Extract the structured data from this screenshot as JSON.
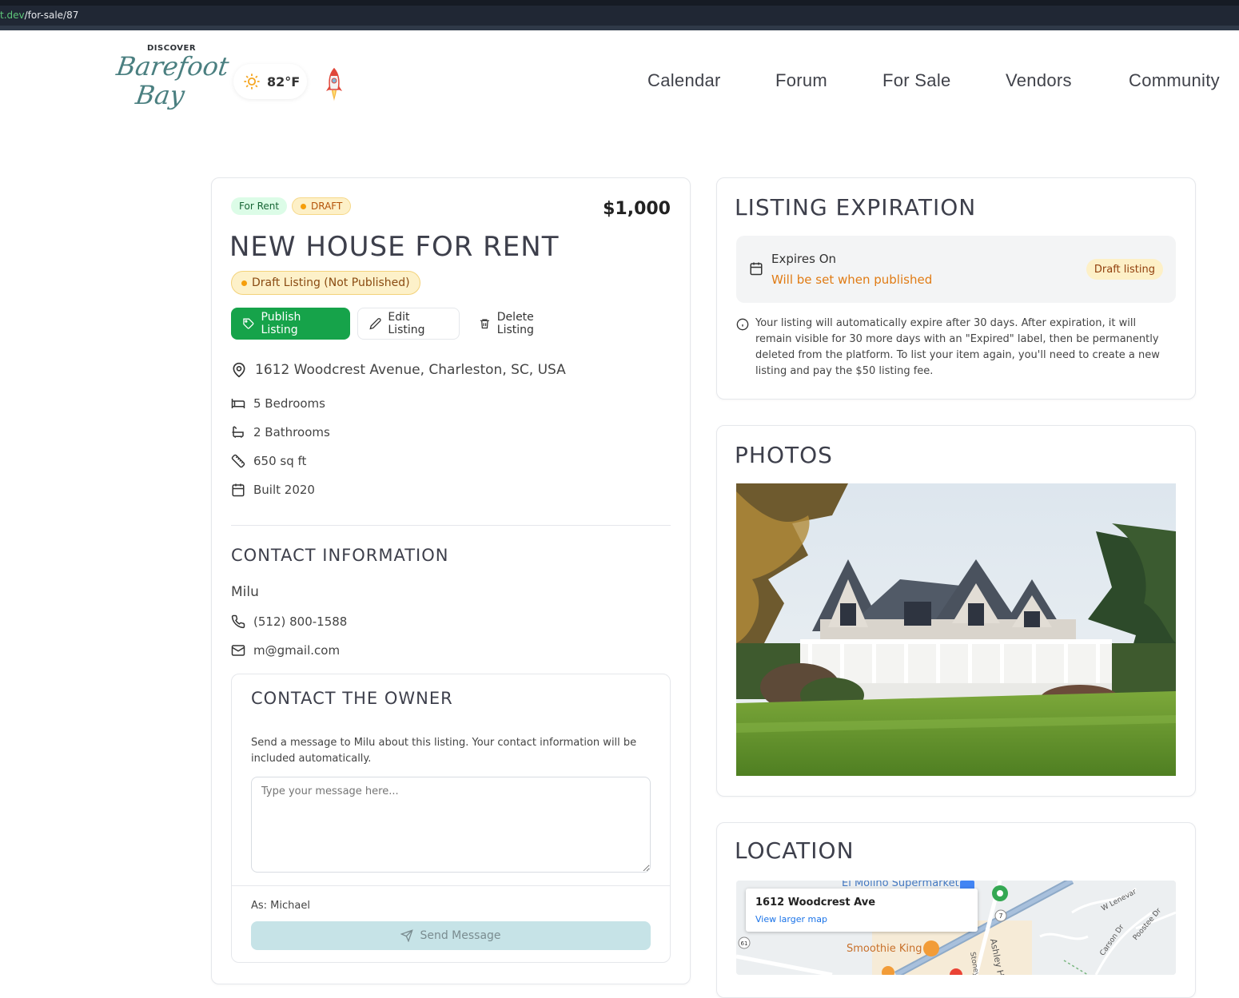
{
  "browser": {
    "url_host": "t.dev",
    "url_path": "/for-sale/87"
  },
  "header": {
    "logo": {
      "line1": "DISCOVER",
      "line2": "Barefoot",
      "line3": "Bay"
    },
    "weather": {
      "temp": "82°F",
      "icon": "sun-icon"
    },
    "nav": [
      "Calendar",
      "Forum",
      "For Sale",
      "Vendors",
      "Community"
    ]
  },
  "listing": {
    "type_badge": "For Rent",
    "status_badge": "DRAFT",
    "price": "$1,000",
    "title": "NEW HOUSE FOR RENT",
    "draft_banner": "Draft Listing (Not Published)",
    "actions": {
      "publish": "Publish Listing",
      "edit": "Edit Listing",
      "delete": "Delete Listing"
    },
    "address": "1612 Woodcrest Avenue, Charleston, SC, USA",
    "bedrooms": "5 Bedrooms",
    "bathrooms": "2 Bathrooms",
    "size": "650 sq ft",
    "built": "Built 2020"
  },
  "contact": {
    "title": "CONTACT INFORMATION",
    "name": "Milu",
    "phone": "(512) 800-1588",
    "email": "m@gmail.com"
  },
  "owner_form": {
    "title": "CONTACT THE OWNER",
    "description": "Send a message to Milu about this listing. Your contact information will be included automatically.",
    "placeholder": "Type your message here...",
    "as_label": "As: Michael",
    "send": "Send Message"
  },
  "expiration": {
    "title": "LISTING EXPIRATION",
    "label": "Expires On",
    "value": "Will be set when published",
    "badge": "Draft listing",
    "note": "Your listing will automatically expire after 30 days. After expiration, it will remain visible for 30 more days with an \"Expired\" label, then be permanently deleted from the platform. To list your item again, you'll need to create a new listing and pay the $50 listing fee."
  },
  "photos": {
    "title": "PHOTOS"
  },
  "location": {
    "title": "LOCATION",
    "place_name": "1612 Woodcrest Ave",
    "view_larger": "View larger map",
    "labels": [
      "El Molino Supermarket",
      "Smoothie King",
      "W Lenevar",
      "Carson Dr",
      "Poostee Dr",
      "Ashley H",
      "Stoney"
    ]
  },
  "colors": {
    "primary_green": "#16a34a",
    "accent_orange": "#e07b14",
    "title_text": "#3d3f4b"
  }
}
